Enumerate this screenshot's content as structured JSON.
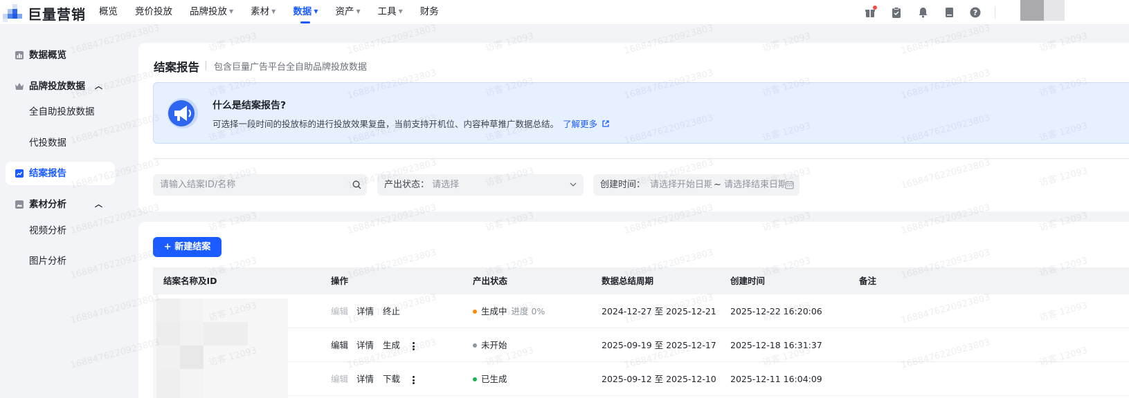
{
  "app": {
    "logo_text": "巨量营销"
  },
  "nav": {
    "items": [
      {
        "label": "概览",
        "caret": false,
        "active": false
      },
      {
        "label": "竞价投放",
        "caret": false,
        "active": false
      },
      {
        "label": "品牌投放",
        "caret": true,
        "active": false
      },
      {
        "label": "素材",
        "caret": true,
        "active": false
      },
      {
        "label": "数据",
        "caret": true,
        "active": true
      },
      {
        "label": "资产",
        "caret": true,
        "active": false
      },
      {
        "label": "工具",
        "caret": true,
        "active": false
      },
      {
        "label": "财务",
        "caret": false,
        "active": false
      }
    ],
    "icons": [
      "gift-icon",
      "clipboard-icon",
      "bell-icon",
      "document-icon",
      "help-icon"
    ]
  },
  "sidebar": {
    "items": [
      {
        "label": "数据概览",
        "type": "group",
        "icon": "bar-chart-icon"
      },
      {
        "label": "品牌投放数据",
        "type": "group",
        "icon": "crown-icon",
        "chevron": "up"
      },
      {
        "label": "全自助投放数据",
        "type": "sub"
      },
      {
        "label": "代投数据",
        "type": "sub"
      },
      {
        "label": "结案报告",
        "type": "group",
        "icon": "trend-icon",
        "active": true
      },
      {
        "label": "素材分析",
        "type": "group",
        "icon": "image-icon",
        "chevron": "up"
      },
      {
        "label": "视频分析",
        "type": "sub"
      },
      {
        "label": "图片分析",
        "type": "sub"
      }
    ]
  },
  "page": {
    "title": "结案报告",
    "subtitle": "包含巨量广告平台全自助品牌投放数据"
  },
  "banner": {
    "title": "什么是结案报告?",
    "description": "可选择一段时间的投放标的进行投放效果复盘，当前支持开机位、内容种草推广数据总结。",
    "link": "了解更多"
  },
  "filters": {
    "search_placeholder": "请输入结案ID/名称",
    "status_label": "产出状态：",
    "status_placeholder": "请选择",
    "date_label": "创建时间：",
    "date_start_placeholder": "请选择开始日期",
    "date_separator": "~",
    "date_end_placeholder": "请选择结束日期"
  },
  "actions": {
    "new_button": "+ 新建结案"
  },
  "table": {
    "columns": [
      "结案名称及ID",
      "操作",
      "产出状态",
      "数据总结周期",
      "创建时间",
      "备注"
    ],
    "rows": [
      {
        "ops": [
          {
            "label": "编辑",
            "disabled": true
          },
          {
            "label": "详情",
            "disabled": false
          },
          {
            "label": "终止",
            "disabled": false
          }
        ],
        "more": false,
        "status": "生成中",
        "status_color": "#ff8a00",
        "progress": "进度 0%",
        "period": "2024-12-27 至 2025-12-21",
        "created": "2025-12-22 16:20:06",
        "note": ""
      },
      {
        "ops": [
          {
            "label": "编辑",
            "disabled": false
          },
          {
            "label": "详情",
            "disabled": false
          },
          {
            "label": "生成",
            "disabled": false
          }
        ],
        "more": true,
        "status": "未开始",
        "status_color": "#8f959e",
        "progress": "",
        "period": "2025-09-19 至 2025-12-17",
        "created": "2025-12-18 16:31:37",
        "note": ""
      },
      {
        "ops": [
          {
            "label": "编辑",
            "disabled": true
          },
          {
            "label": "详情",
            "disabled": false
          },
          {
            "label": "下载",
            "disabled": false
          }
        ],
        "more": true,
        "status": "已生成",
        "status_color": "#1bb34e",
        "progress": "",
        "period": "2025-09-12 至 2025-12-10",
        "created": "2025-12-11 16:04:09",
        "note": ""
      }
    ]
  },
  "watermark": {
    "id": "1688476220923803",
    "visitor": "访客 12093"
  },
  "colors": {
    "accent": "#1a5cff",
    "banner_bg": "#e7f0ff",
    "page_bg": "#f3f4f7"
  }
}
